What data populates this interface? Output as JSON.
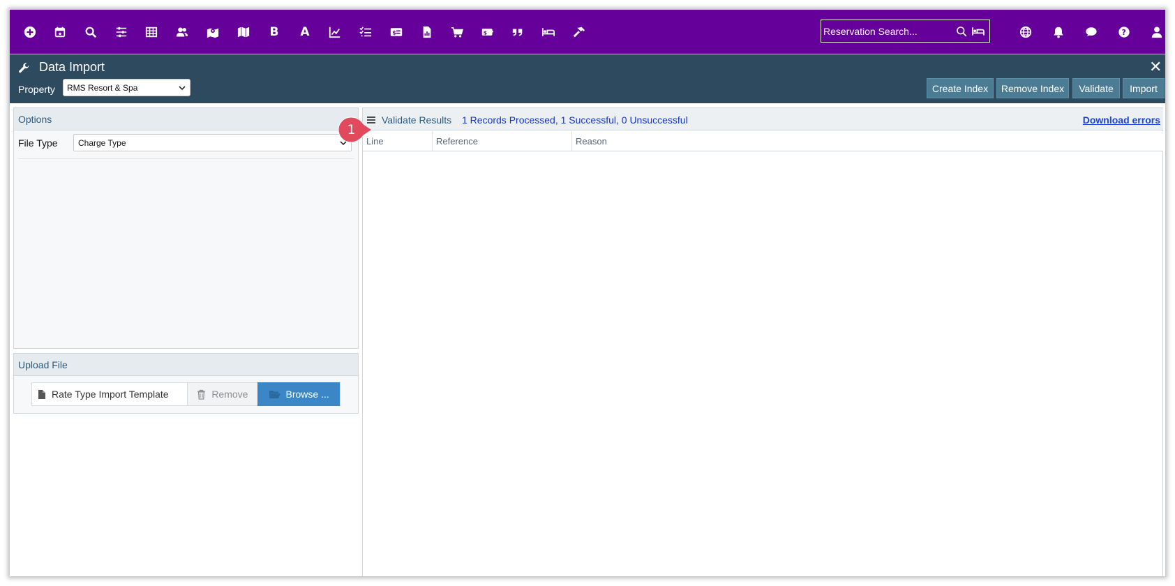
{
  "topbar": {
    "icons": [
      "add-circle-icon",
      "calendar-icon",
      "search-icon",
      "sliders-icon",
      "grid-icon",
      "users-icon",
      "map-pin-icon",
      "map-icon",
      "bold-b-icon",
      "letter-a-icon",
      "line-chart-icon",
      "checklist-icon",
      "id-card-icon",
      "report-file-icon",
      "shopping-cart-icon",
      "payment-card-icon",
      "quote-icon",
      "bed-icon",
      "hammer-icon"
    ],
    "letters": {
      "bold": "B",
      "a": "A"
    },
    "search_placeholder": "Reservation Search...",
    "right_icons": [
      "globe-icon",
      "bell-icon",
      "chat-icon",
      "help-icon",
      "user-icon"
    ]
  },
  "titlebar": {
    "title": "Data Import",
    "property_label": "Property",
    "property_value": "RMS Resort & Spa",
    "buttons": {
      "create_index": "Create Index",
      "remove_index": "Remove Index",
      "validate": "Validate",
      "import": "Import"
    }
  },
  "options": {
    "header": "Options",
    "file_type_label": "File Type",
    "file_type_value": "Charge Type"
  },
  "upload": {
    "header": "Upload File",
    "file_name": "Rate Type Import Template",
    "remove_label": "Remove",
    "browse_label": "Browse ..."
  },
  "results": {
    "title": "Validate Results",
    "summary": "1 Records Processed, 1 Successful, 0 Unsuccessful",
    "download_link": "Download errors",
    "columns": [
      "Line",
      "Reference",
      "Reason"
    ]
  },
  "annotation": {
    "step": "1",
    "color": "#e04a5c"
  },
  "colors": {
    "topbar": "#66009a",
    "titlebar": "#2e4a5f",
    "header_button": "#4c7c94",
    "browse_button": "#3b86c6"
  }
}
